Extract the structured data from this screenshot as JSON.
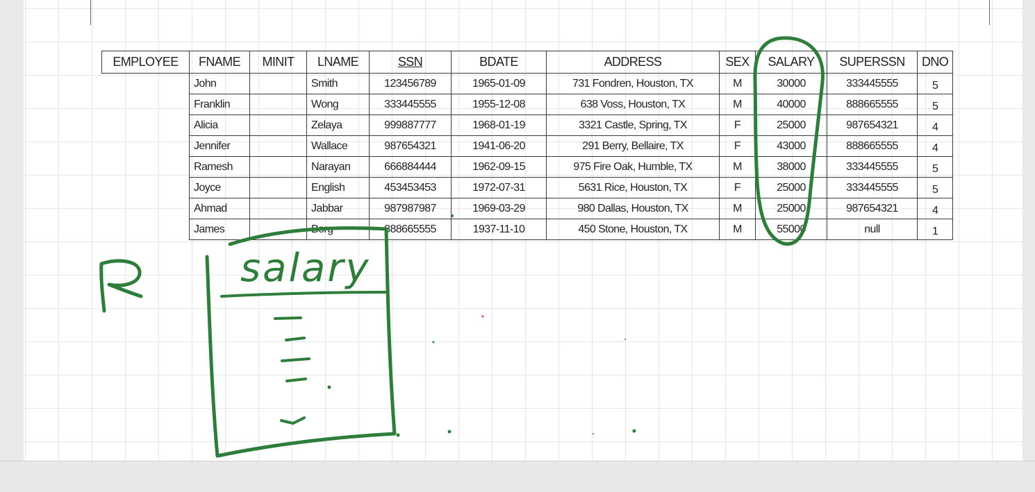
{
  "table": {
    "relation_name": "EMPLOYEE",
    "headers": [
      {
        "label": "FNAME",
        "key": false
      },
      {
        "label": "MINIT",
        "key": false
      },
      {
        "label": "LNAME",
        "key": false
      },
      {
        "label": "SSN",
        "key": true
      },
      {
        "label": "BDATE",
        "key": false
      },
      {
        "label": "ADDRESS",
        "key": false
      },
      {
        "label": "SEX",
        "key": false
      },
      {
        "label": "SALARY",
        "key": false
      },
      {
        "label": "SUPERSSN",
        "key": false
      },
      {
        "label": "DNO",
        "key": false
      }
    ],
    "rows": [
      [
        "John",
        "",
        "Smith",
        "123456789",
        "1965-01-09",
        "731 Fondren, Houston, TX",
        "M",
        "30000",
        "333445555",
        "5"
      ],
      [
        "Franklin",
        "",
        "Wong",
        "333445555",
        "1955-12-08",
        "638 Voss, Houston, TX",
        "M",
        "40000",
        "888665555",
        "5"
      ],
      [
        "Alicia",
        "",
        "Zelaya",
        "999887777",
        "1968-01-19",
        "3321 Castle, Spring, TX",
        "F",
        "25000",
        "987654321",
        "4"
      ],
      [
        "Jennifer",
        "",
        "Wallace",
        "987654321",
        "1941-06-20",
        "291 Berry, Bellaire, TX",
        "F",
        "43000",
        "888665555",
        "4"
      ],
      [
        "Ramesh",
        "",
        "Narayan",
        "666884444",
        "1962-09-15",
        "975 Fire Oak, Humble, TX",
        "M",
        "38000",
        "333445555",
        "5"
      ],
      [
        "Joyce",
        "",
        "English",
        "453453453",
        "1972-07-31",
        "5631 Rice, Houston, TX",
        "F",
        "25000",
        "333445555",
        "5"
      ],
      [
        "Ahmad",
        "",
        "Jabbar",
        "987987987",
        "1969-03-29",
        "980 Dallas, Houston, TX",
        "M",
        "25000",
        "987654321",
        "4"
      ],
      [
        "James",
        "",
        "Borg",
        "888665555",
        "1937-11-10",
        "450 Stone, Houston, TX",
        "M",
        "55000",
        "null",
        "1"
      ]
    ]
  },
  "handwriting": {
    "relation_letter": "R",
    "column_label": "salary",
    "ink_color": "#2e7d3a"
  },
  "colors": {
    "canvas": "#ffffff",
    "background": "#e9e9ea",
    "table_border": "#3a3a3a"
  }
}
